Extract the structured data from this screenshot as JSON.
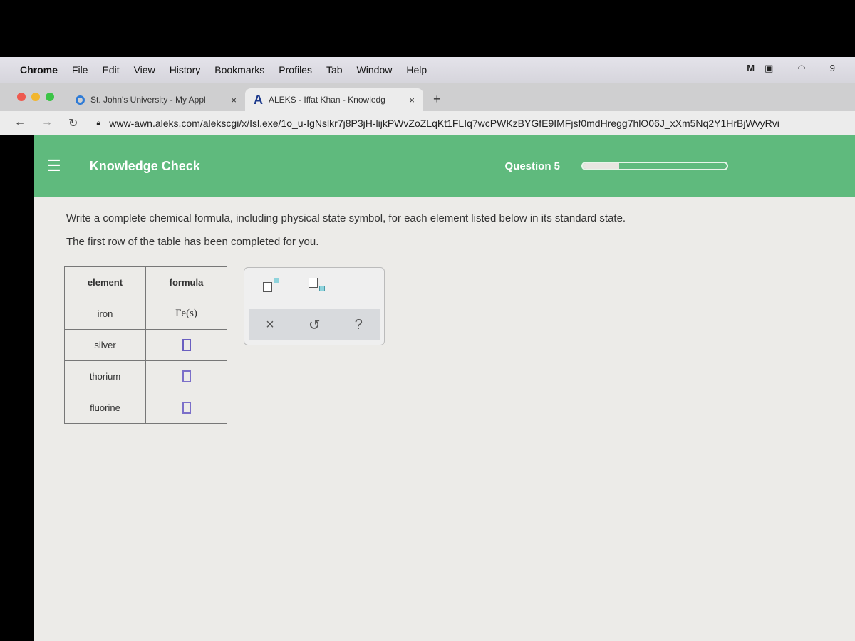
{
  "menubar": {
    "app": "Chrome",
    "items": [
      "File",
      "Edit",
      "View",
      "History",
      "Bookmarks",
      "Profiles",
      "Tab",
      "Window",
      "Help"
    ],
    "clock_partial": "9"
  },
  "tabs": [
    {
      "label": "St. John's University - My Appl",
      "close": "×"
    },
    {
      "label": "ALEKS - Iffat Khan - Knowledg",
      "close": "×",
      "icon_letter": "A"
    }
  ],
  "new_tab": "+",
  "address": {
    "url": "www-awn.aleks.com/alekscgi/x/Isl.exe/1o_u-IgNslkr7j8P3jH-lijkPWvZoZLqKt1FLIq7wcPWKzBYGfE9IMFjsf0mdHregg7hlO06J_xXm5Nq2Y1HrBjWvyRvi"
  },
  "header": {
    "title": "Knowledge Check",
    "question": "Question 5",
    "progress_percent": 25,
    "color": "#5fba7d"
  },
  "instructions": [
    "Write a complete chemical formula, including physical state symbol, for each element listed below in its standard state.",
    "The first row of the table has been completed for you."
  ],
  "table": {
    "headers": [
      "element",
      "formula"
    ],
    "rows": [
      {
        "element": "iron",
        "formula": "Fe(s)"
      },
      {
        "element": "silver",
        "formula": ""
      },
      {
        "element": "thorium",
        "formula": ""
      },
      {
        "element": "fluorine",
        "formula": ""
      }
    ]
  },
  "palette": {
    "buttons": [
      "superscript-icon",
      "subscript-icon",
      "clear-icon",
      "undo-icon",
      "help-icon"
    ],
    "clear": "×",
    "undo": "↺",
    "help": "?"
  }
}
